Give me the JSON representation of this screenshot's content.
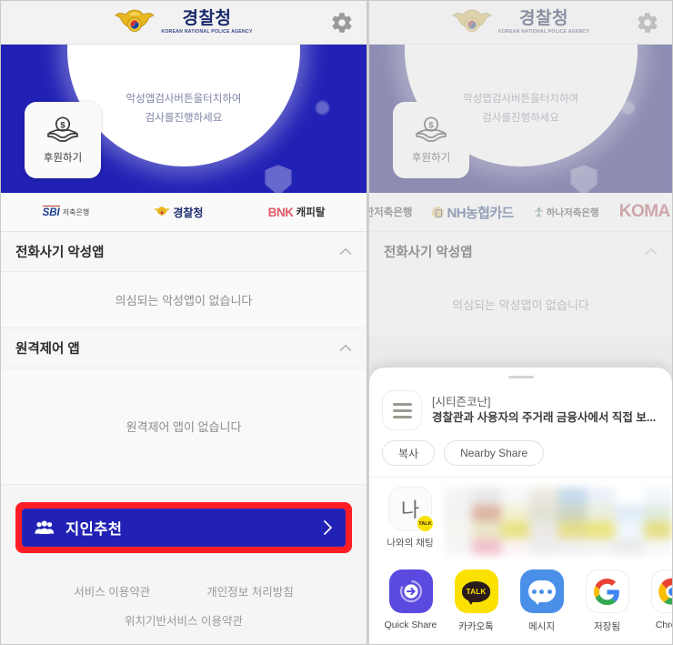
{
  "colors": {
    "hero_blue": "#2121b5",
    "highlight_red": "#ff1d25",
    "brand_navy": "#1a2a6c",
    "kakao_yellow": "#fae100",
    "quick_share_purple": "#5b4ae0",
    "message_blue": "#4a90e8"
  },
  "header": {
    "brand_ko": "경찰청",
    "brand_en": "KOREAN NATIONAL POLICE AGENCY",
    "settings_icon": "gear-icon"
  },
  "hero": {
    "message_line1": "악성앱검사버튼을터치하여",
    "message_line2": "검사를진행하세요",
    "donate_label": "후원하기",
    "donate_icon": "money-in-hands-icon"
  },
  "partners_left": [
    {
      "name": "SBI 저축은행",
      "mark": "SBI",
      "sub": "저축은행"
    },
    {
      "name": "경찰청",
      "mark": "police-emblem-icon",
      "sub": "경찰청"
    },
    {
      "name": "BNK 캐피탈",
      "mark": "BNK",
      "sub": "캐피탈"
    }
  ],
  "partners_right": [
    {
      "name": "신한저축은행"
    },
    {
      "name": "NH농협카드"
    },
    {
      "name": "하나저축은행"
    },
    {
      "name": "KOMA"
    }
  ],
  "sections": [
    {
      "title": "전화사기 악성앱",
      "empty_text": "의심되는 악성앱이 없습니다",
      "chevron": "chevron-up-icon"
    },
    {
      "title": "원격제어 앱",
      "empty_text": "원격제어 앱이 없습니다",
      "chevron": "chevron-up-icon"
    }
  ],
  "refer": {
    "label": "지인추천",
    "icon": "people-group-icon",
    "chevron": "chevron-right-icon"
  },
  "footer": {
    "terms_of_service": "서비스 이용약관",
    "privacy_policy": "개인정보 처리방침",
    "location_terms": "위치기반서비스 이용약관"
  },
  "share_sheet": {
    "app_icon": "hamburger-menu-icon",
    "preview_title": "[시티즌코난]",
    "preview_desc": "경찰관과 사용자의 주거래 금융사에서 직접 보...",
    "chips": [
      {
        "label": "복사"
      },
      {
        "label": "Nearby Share"
      }
    ],
    "contact_self": {
      "avatar_text": "나",
      "badge": "TALK",
      "label": "나와의 채팅"
    },
    "blurred_contacts_count": 32,
    "apps": [
      {
        "label": "Quick Share",
        "icon": "quick-share-icon"
      },
      {
        "label": "카카오톡",
        "icon": "kakaotalk-icon"
      },
      {
        "label": "메시지",
        "icon": "messages-icon"
      },
      {
        "label": "저장됨",
        "icon": "google-icon"
      },
      {
        "label": "Chrome",
        "icon": "chrome-icon"
      }
    ]
  }
}
